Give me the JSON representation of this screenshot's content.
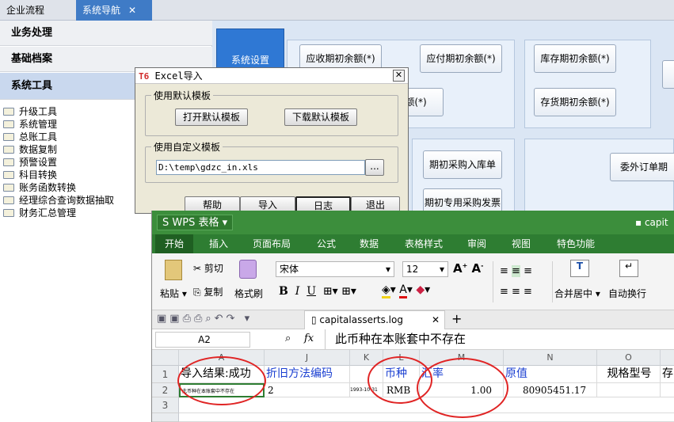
{
  "tabs": [
    {
      "label": "企业流程"
    },
    {
      "label": "系统导航",
      "close": "✕"
    }
  ],
  "sidebar": {
    "sections": [
      "业务处理",
      "基础档案",
      "系统工具"
    ],
    "tree": [
      "升级工具",
      "系统管理",
      "总账工具",
      "数据复制",
      "预警设置",
      "科目转换",
      "账务函数转换",
      "经理综合查询数据抽取",
      "财务汇总管理"
    ]
  },
  "nav": {
    "system_settings": "系统设置",
    "buttons": [
      "应收期初余额(*)",
      "应付期初余额(*)",
      "库存期初余额(*)",
      "余额(*)",
      "存货期初余额(*)",
      "期初采购入库单",
      "委外订单期初",
      "期初专用采购发票"
    ]
  },
  "dialog": {
    "logo": "T6",
    "title": "Excel导入",
    "close": "✕",
    "group1": "使用默认模板",
    "open_default": "打开默认模板",
    "download_default": "下载默认模板",
    "group2": "使用自定义模板",
    "path": "D:\\temp\\gdzc_in.xls",
    "browse": "...",
    "help": "帮助",
    "import": "导入",
    "log": "日志",
    "exit": "退出"
  },
  "wps": {
    "app_name": "WPS 表格",
    "right_title": "capit",
    "menus": [
      "开始",
      "插入",
      "页面布局",
      "公式",
      "数据",
      "表格样式",
      "审阅",
      "视图",
      "特色功能"
    ],
    "ribbon": {
      "paste": "粘贴",
      "cut": "剪切",
      "copy": "复制",
      "format_painter": "格式刷",
      "font": "宋体",
      "size": "12",
      "merge": "合并居中",
      "wrap": "自动换行"
    },
    "file_tab": "capitalasserts.log",
    "cell_ref": "A2",
    "fx": "fx",
    "formula": "此币种在本账套中不存在",
    "columns": [
      "A",
      "J",
      "K",
      "L",
      "M",
      "N",
      "O"
    ],
    "rows": [
      "1",
      "2",
      "3"
    ],
    "row1": [
      "导入结果:成功",
      "折旧方法编码",
      "",
      "币种",
      "汇率",
      "原值",
      "规格型号",
      "存"
    ],
    "row2": [
      "此币种在本账套中不存在",
      "2",
      "1993-10-31",
      "RMB",
      "1.00",
      "80905451.17",
      ""
    ]
  },
  "colors": {
    "wps_green": "#2e7d32",
    "accent_blue": "#2f78d4",
    "annotation_red": "#e02525"
  }
}
